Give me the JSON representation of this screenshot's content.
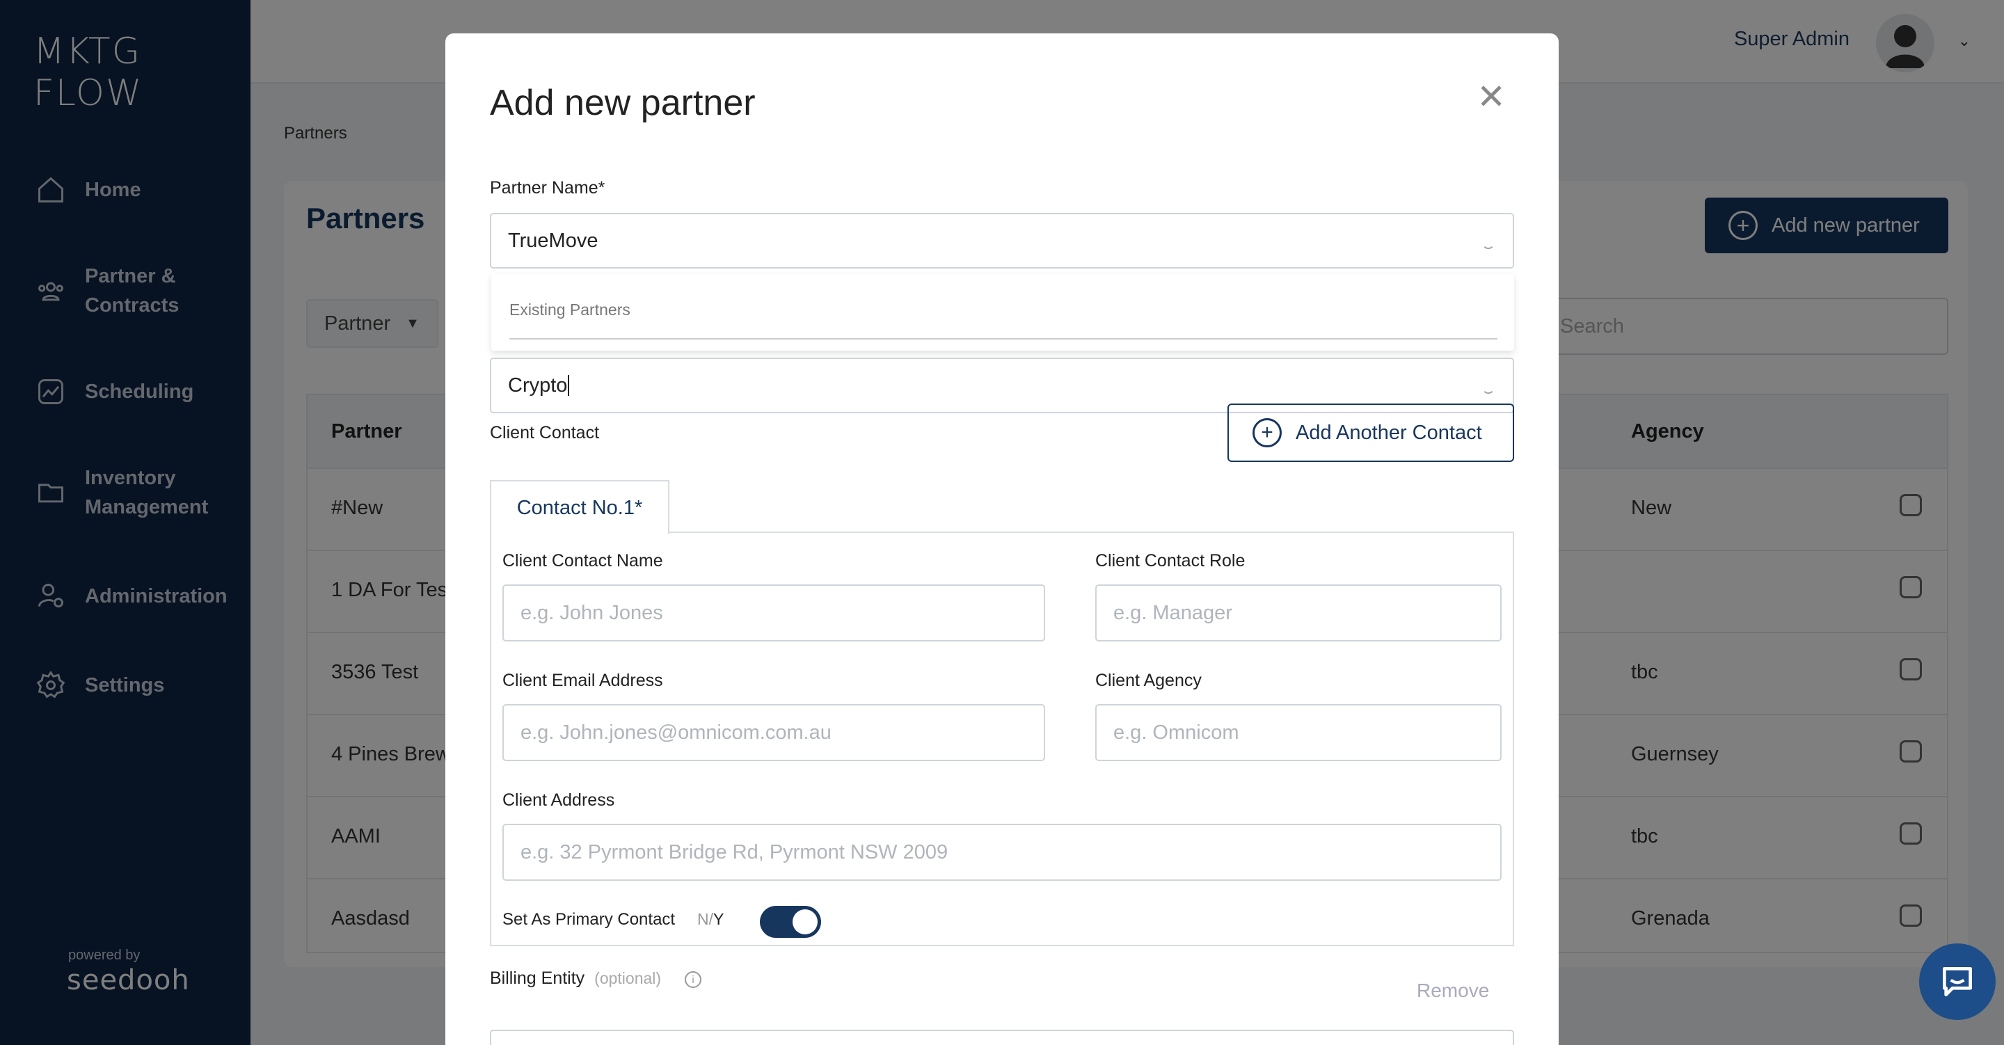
{
  "sidebar": {
    "logo": "MKTG FLOW",
    "items": [
      {
        "label": "Home",
        "icon": "home-icon"
      },
      {
        "label": "Partner &\nContracts",
        "icon": "users-icon"
      },
      {
        "label": "Scheduling",
        "icon": "chart-icon"
      },
      {
        "label": "Inventory\nManagement",
        "icon": "folder-icon"
      },
      {
        "label": "Administration",
        "icon": "admin-icon"
      },
      {
        "label": "Settings",
        "icon": "gear-icon"
      }
    ],
    "powered_by": "powered by",
    "brand": "seedooh"
  },
  "header": {
    "user_name": "Super Admin"
  },
  "page": {
    "breadcrumb": "Partners",
    "title": "Partners",
    "add_button": "Add new partner",
    "filter_label": "Partner",
    "search_placeholder": "Search"
  },
  "table": {
    "columns": [
      "Partner",
      "Agency"
    ],
    "rows": [
      {
        "partner": "#New",
        "agency": "New"
      },
      {
        "partner": "1 DA For Tes",
        "agency": ""
      },
      {
        "partner": "3536 Test",
        "agency": "tbc"
      },
      {
        "partner": "4 Pines Brew",
        "agency": "Guernsey"
      },
      {
        "partner": "AAMI",
        "agency": "tbc"
      },
      {
        "partner": "Aasdasd",
        "agency": "Grenada"
      }
    ]
  },
  "modal": {
    "title": "Add new partner",
    "partner_name_label": "Partner Name*",
    "partner_name_value": "TrueMove",
    "category_value": "Crypto",
    "dropdown_header": "Existing Partners",
    "client_contact_label": "Client Contact",
    "add_contact_button": "Add Another Contact",
    "contact_tab": "Contact No.1*",
    "contact_name_label": "Client Contact Name",
    "contact_name_placeholder": "e.g. John Jones",
    "contact_role_label": "Client Contact Role",
    "contact_role_placeholder": "e.g. Manager",
    "email_label": "Client Email Address",
    "email_placeholder": "e.g. John.jones@omnicom.com.au",
    "agency_label": "Client Agency",
    "agency_placeholder": "e.g. Omnicom",
    "address_label": "Client Address",
    "address_placeholder": "e.g. 32 Pyrmont Bridge Rd, Pyrmont NSW 2009",
    "primary_label": "Set As Primary Contact",
    "toggle_n": "N/",
    "toggle_y": "Y",
    "primary_on": true,
    "billing_label": "Billing Entity",
    "billing_optional": "(optional)",
    "remove_label": "Remove"
  },
  "colors": {
    "sidebar": "#0e2444",
    "accent": "#17365e",
    "chat": "#1d4e89"
  }
}
